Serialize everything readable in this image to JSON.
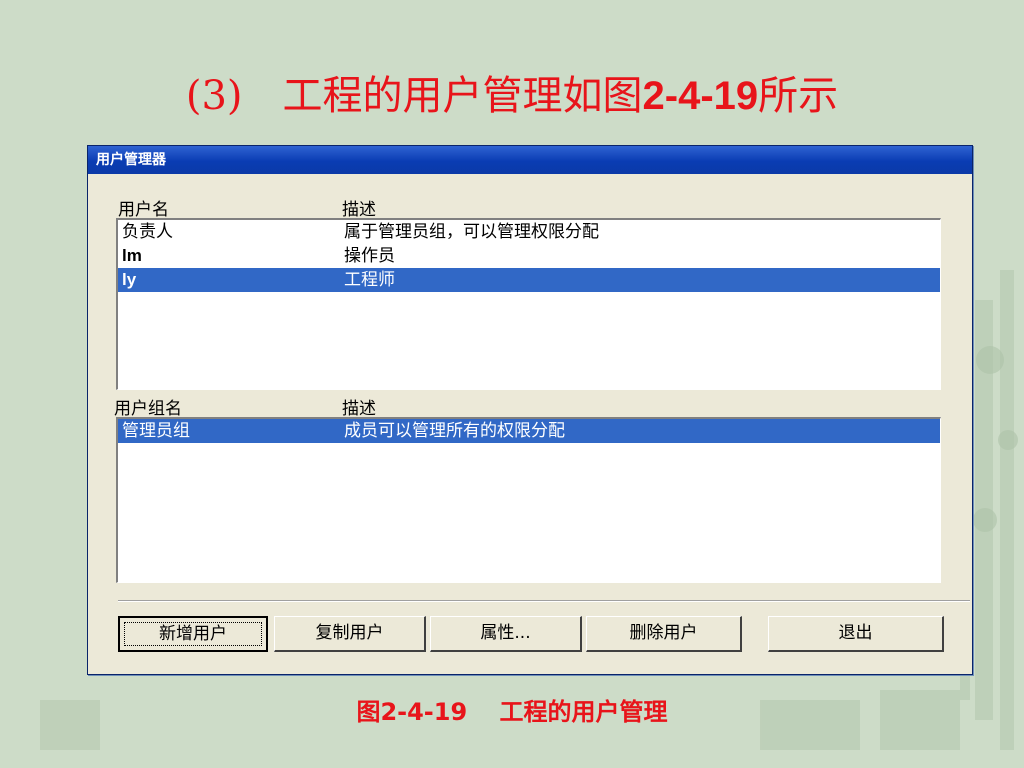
{
  "slide": {
    "title_prefix": "(3)　工程的用户管理如图",
    "title_number": "2-4-19",
    "title_suffix": "所示",
    "caption": "图2-4-19　 工程的用户管理"
  },
  "dialog": {
    "title": "用户管理器",
    "users": {
      "col_name": "用户名",
      "col_desc": "描述",
      "rows": [
        {
          "name": "负责人",
          "desc": "属于管理员组，可以管理权限分配",
          "selected": false
        },
        {
          "name": "lm",
          "desc": "操作员",
          "selected": false
        },
        {
          "name": "ly",
          "desc": "工程师",
          "selected": true
        }
      ]
    },
    "groups": {
      "col_name": "用户组名",
      "col_desc": "描述",
      "rows": [
        {
          "name": "管理员组",
          "desc": "成员可以管理所有的权限分配",
          "selected": true
        }
      ]
    },
    "buttons": {
      "add_user": "新增用户",
      "copy_user": "复制用户",
      "properties": "属性...",
      "delete_user": "删除用户",
      "exit": "退出"
    }
  },
  "colors": {
    "title_red": "#e8141a",
    "selection_blue": "#3168c6",
    "titlebar_blue": "#0a3cb3",
    "dialog_bg": "#ece9d8",
    "slide_bg": "#cddcc8"
  }
}
